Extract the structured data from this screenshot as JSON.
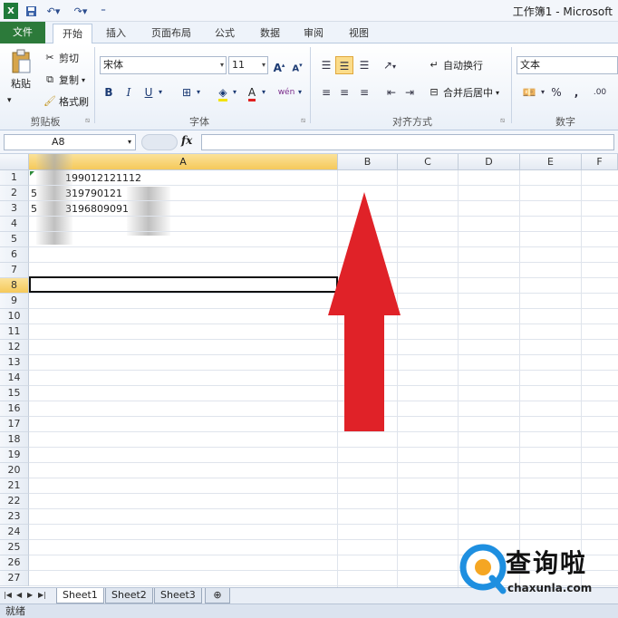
{
  "window": {
    "title": "工作簿1 - Microsoft"
  },
  "quick_access": {
    "icons": [
      "excel-logo-icon",
      "save-icon",
      "undo-icon",
      "redo-icon",
      "customize-icon"
    ]
  },
  "tabs": [
    {
      "label": "文件"
    },
    {
      "label": "开始"
    },
    {
      "label": "插入"
    },
    {
      "label": "页面布局"
    },
    {
      "label": "公式"
    },
    {
      "label": "数据"
    },
    {
      "label": "审阅"
    },
    {
      "label": "视图"
    }
  ],
  "ribbon": {
    "clipboard": {
      "paste": "粘贴",
      "cut": "剪切",
      "copy": "复制",
      "format_painter": "格式刷",
      "group": "剪贴板"
    },
    "font": {
      "name": "宋体",
      "size": "11",
      "bold": "B",
      "italic": "I",
      "underline": "U",
      "grow": "A",
      "shrink": "A",
      "group": "字体"
    },
    "alignment": {
      "wrap": "自动换行",
      "merge": "合并后居中",
      "group": "对齐方式"
    },
    "number": {
      "format": "文本",
      "percent": "%",
      "comma": ",",
      "group": "数字"
    }
  },
  "formula_bar": {
    "name_box": "A8",
    "fx": "fx",
    "content": ""
  },
  "grid": {
    "columns": [
      "A",
      "B",
      "C",
      "D",
      "E",
      "F"
    ],
    "selected_column": "A",
    "rows": [
      "1",
      "2",
      "3",
      "4",
      "5",
      "6",
      "7",
      "8",
      "9",
      "10",
      "11",
      "12",
      "13",
      "14",
      "15",
      "16",
      "17",
      "18",
      "19",
      "20",
      "21",
      "22",
      "23",
      "24",
      "25",
      "26",
      "27"
    ],
    "selected_row": "8",
    "cells": [
      {
        "ref": "A1",
        "visible_text": "199012121112"
      },
      {
        "ref": "A2",
        "visible_text": "319790121"
      },
      {
        "ref": "A3",
        "visible_text": "3196809091"
      }
    ],
    "row_prefix_marks": [
      "5",
      "5"
    ]
  },
  "sheets": [
    {
      "label": "Sheet1"
    },
    {
      "label": "Sheet2"
    },
    {
      "label": "Sheet3"
    }
  ],
  "status": {
    "text": "就绪"
  },
  "watermark": {
    "name": "查询啦",
    "url": "chaxunla.com"
  },
  "colors": {
    "accent_file_tab": "#2c7a3a",
    "selection_header": "#f5c95a",
    "arrow": "#e02228"
  }
}
